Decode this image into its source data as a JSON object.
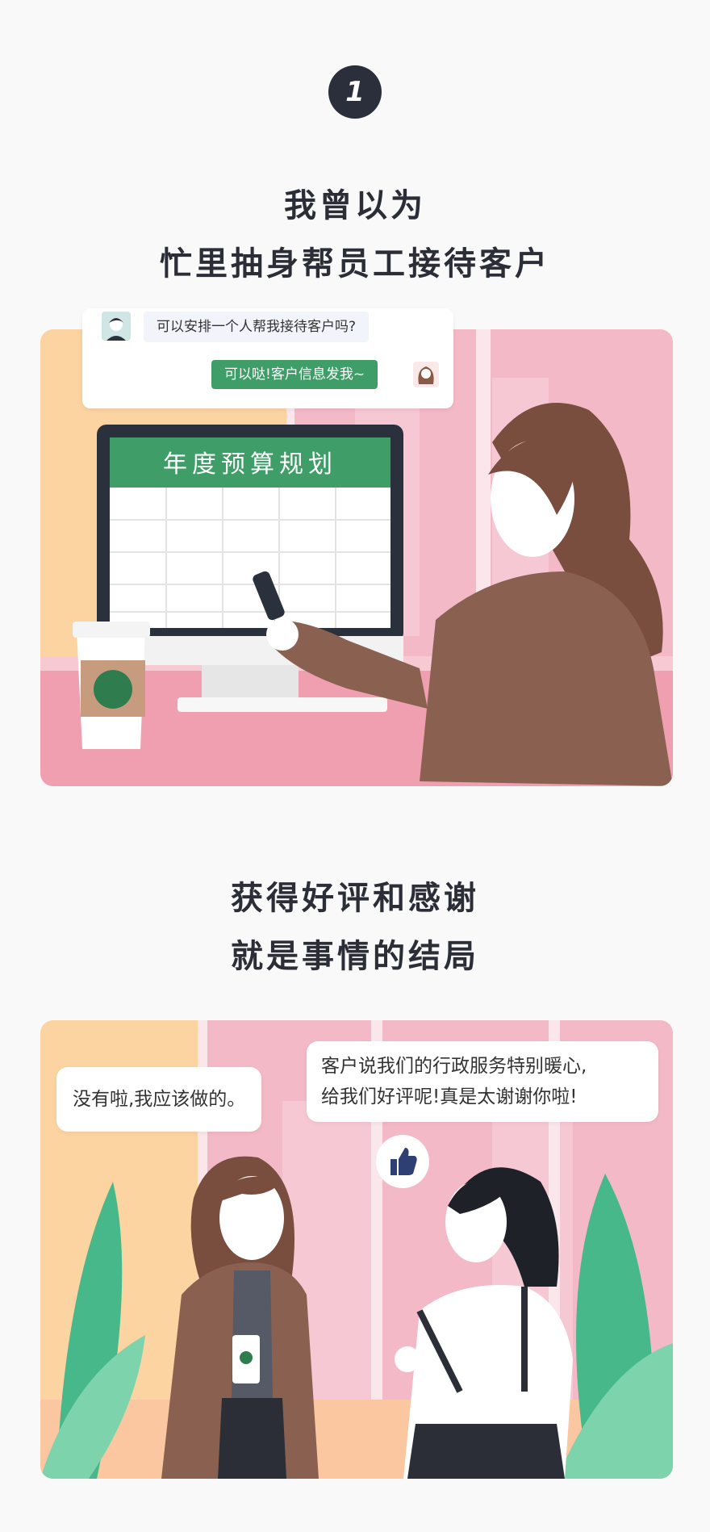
{
  "step": {
    "number": "1"
  },
  "section1": {
    "heading_line1": "我曾以为",
    "heading_line2": "忙里抽身帮员工接待客户",
    "chat": {
      "question": "可以安排一个人帮我接待客户吗?",
      "reply": "可以哒!客户信息发我~"
    },
    "screen_title": "年度预算规划"
  },
  "section2": {
    "heading_line1": "获得好评和感谢",
    "heading_line2": "就是事情的结局",
    "bubble_left": "没有啦,我应该做的。",
    "bubble_right_line1": "客户说我们的行政服务特别暖心,",
    "bubble_right_line2": "给我们好评呢!真是太谢谢你啦!"
  },
  "colors": {
    "dark": "#2b2e36",
    "green": "#3f9e68",
    "pink": "#f1b6c4",
    "peach": "#fbd4a2",
    "brown": "#7a5544"
  },
  "icons": [
    "user-avatar-icon",
    "woman-avatar-icon",
    "thumbs-up-icon"
  ]
}
